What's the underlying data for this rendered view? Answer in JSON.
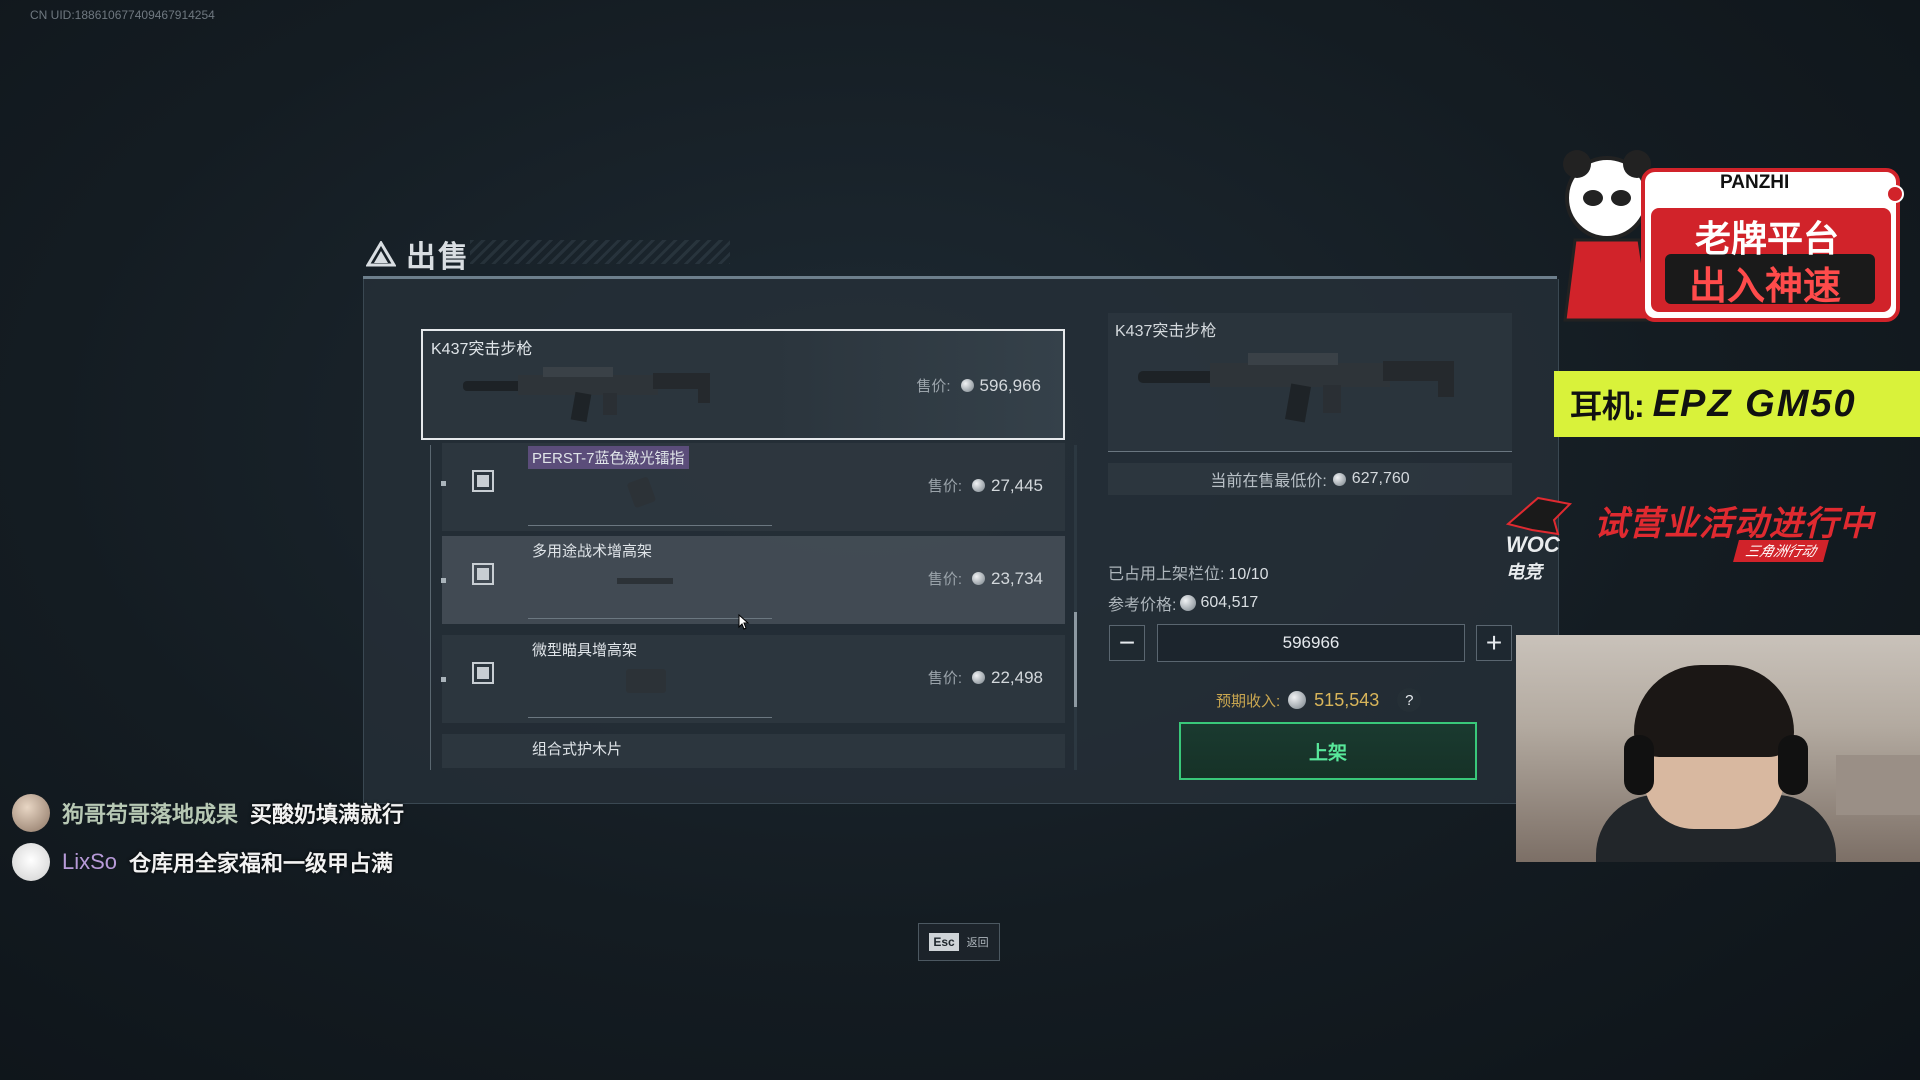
{
  "overlay": {
    "uid": "CN UID:18861067740946791​4254"
  },
  "panel": {
    "title": "出售"
  },
  "items": {
    "main": {
      "name": "K437突击步枪",
      "price_label": "售价:",
      "price": "596,966"
    },
    "subs": [
      {
        "name": "PERST-7蓝色激光镭指",
        "price_label": "售价:",
        "price": "27,445"
      },
      {
        "name": "多用途战术增高架",
        "price_label": "售价:",
        "price": "23,734"
      },
      {
        "name": "微型瞄具增高架",
        "price_label": "售价:",
        "price": "22,498"
      },
      {
        "name": "组合式护木片"
      }
    ]
  },
  "detail": {
    "name": "K437突击步枪",
    "lowest_label": "当前在售最低价:",
    "lowest_price": "627,760",
    "slots_label": "已占用上架栏位:",
    "slots_value": "10/10",
    "ref_label": "参考价格:",
    "ref_price": "604,517",
    "quantity": "596966",
    "minus": "−",
    "plus": "+",
    "income_label": "预期收入:",
    "income_value": "515,543",
    "help": "?",
    "list_button": "上架"
  },
  "footer": {
    "esc_key": "Esc",
    "esc_label": "返回"
  },
  "chat": [
    {
      "user": "狗哥苟哥落地成果",
      "message": "买酸奶填满就行"
    },
    {
      "user": "LixSo",
      "message": "仓库用全家福和一级甲占满"
    }
  ],
  "ads": {
    "panzhi_brand": "PANZHI",
    "panzhi_line1": "老牌平台",
    "panzhi_line2": "出入神速",
    "epz_label": "耳机:",
    "epz_brand": "EPZ GM50",
    "woc_logo": "WOC",
    "woc_sub": "电竞",
    "woc_slogan": "试营业活动进行中",
    "woc_tag": "三角洲行动"
  },
  "colors": {
    "accent_green": "#39c87a",
    "gold": "#d8b55a",
    "ad_yellow": "#d9f23a",
    "ad_red": "#e02a30"
  }
}
